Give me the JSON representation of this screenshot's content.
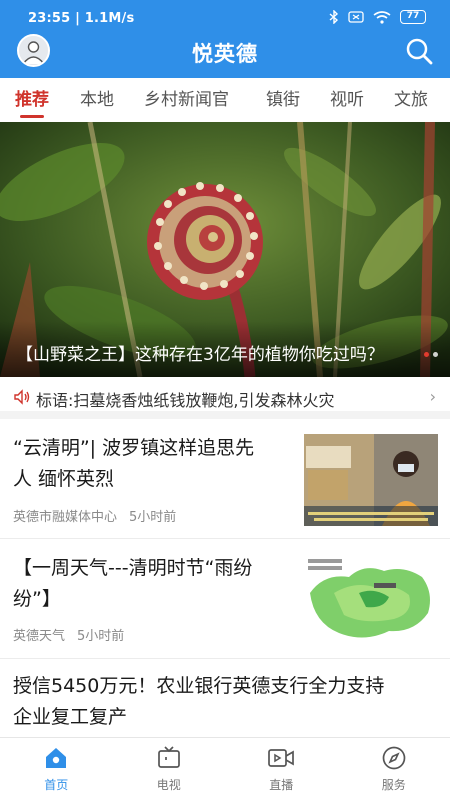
{
  "status_bar": {
    "time": "23:55 | 1.1M/s",
    "battery": "77"
  },
  "header": {
    "title": "悦英德",
    "avatar_icon": "user-avatar",
    "search_icon": "search-icon"
  },
  "tabs": [
    {
      "label": "推荐",
      "active": true
    },
    {
      "label": "本地",
      "active": false
    },
    {
      "label": "乡村新闻官",
      "active": false
    },
    {
      "label": "镇街",
      "active": false
    },
    {
      "label": "视听",
      "active": false
    },
    {
      "label": "文旅",
      "active": false
    }
  ],
  "banner": {
    "caption": "【山野菜之王】这种存在3亿年的植物你吃过吗？"
  },
  "notice": {
    "text": "标语:扫墓烧香烛纸钱放鞭炮,引发森林火灾"
  },
  "news": [
    {
      "title_line1": "“云清明”| 波罗镇这样追思先",
      "title_line2": "人 缅怀英烈",
      "source": "英德市融媒体中心",
      "time": "5小时前"
    },
    {
      "title_line1": "【一周天气---清明时节“雨纷",
      "title_line2": "纷”】",
      "source": "英德天气",
      "time": "5小时前"
    },
    {
      "title_line1": "授信5450万元！农业银行英德支行全力支持",
      "title_line2": "企业复工复产"
    }
  ],
  "bottom_nav": [
    {
      "label": "首页",
      "icon": "home-icon",
      "active": true
    },
    {
      "label": "电视",
      "icon": "tv-icon",
      "active": false
    },
    {
      "label": "直播",
      "icon": "live-video-icon",
      "active": false
    },
    {
      "label": "服务",
      "icon": "compass-icon",
      "active": false
    }
  ],
  "colors": {
    "brand_blue": "#2f8fe8",
    "active_tab_red": "#d0342c"
  }
}
